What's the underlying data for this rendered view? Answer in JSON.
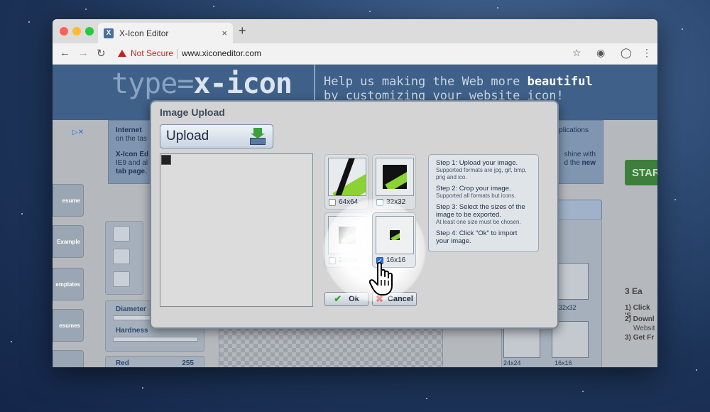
{
  "browser": {
    "tab_title": "X-Icon Editor",
    "tab_close": "×",
    "new_tab": "+",
    "security_label": "Not Secure",
    "url": "www.xiconeditor.com"
  },
  "page": {
    "logo_prefix": "type=",
    "logo_main": "x-icon",
    "tagline_line1": "Help us making the Web more ",
    "tagline_bold": "beautiful",
    "tagline_line2": "by customizing your website icon!",
    "info_title1": "Internet",
    "info_text1": "on the tas",
    "info_title2": "X-Icon Ed",
    "info_text2": "IE9 and al",
    "info_text3": "tab page.",
    "info_right1": "plications",
    "info_right2": "shine with",
    "info_right3": "d the ",
    "info_right3_bold": "new",
    "sidebar": [
      "esume",
      "Example",
      "emplates",
      "esumes"
    ],
    "diameter_label": "Diameter",
    "hardness_label": "Hardness",
    "red_label": "Red",
    "red_value": "255",
    "red_level": 1.0,
    "start_label": "STAR",
    "easy_title": "3 Ea",
    "easy_steps": [
      "1) Click 'S",
      "2) Downl",
      "Websit",
      "3) Get Fr"
    ],
    "right_captions": [
      "32x32",
      "24x24",
      "16x16"
    ]
  },
  "dialog": {
    "title": "Image Upload",
    "upload_label": "Upload",
    "thumbnails": [
      {
        "label": "64x64",
        "checked": false
      },
      {
        "label": "32x32",
        "checked": false
      },
      {
        "label": "24x24",
        "checked": false
      },
      {
        "label": "16x16",
        "checked": true
      }
    ],
    "steps": [
      {
        "title": "Step 1: Upload your image.",
        "sub": "Supported formats are jpg, gif, bmp, png and ico."
      },
      {
        "title": "Step 2: Crop your image.",
        "sub": "Supported all formats but icons."
      },
      {
        "title": "Step 3: Select the sizes of the image to be exported.",
        "sub": "At least one size must be chosen."
      },
      {
        "title": "Step 4: Click \"Ok\" to import your image.",
        "sub": ""
      }
    ],
    "ok_label": "Ok",
    "cancel_label": "Cancel"
  },
  "colors": {
    "accent_green": "#8cd234",
    "check_blue": "#2d74d2",
    "cancel_red": "#d0282b"
  },
  "icons": [
    "favicon-icon",
    "warning-icon",
    "star-icon",
    "upload-icon",
    "check-icon",
    "cancel-icon",
    "hand-cursor-icon"
  ]
}
